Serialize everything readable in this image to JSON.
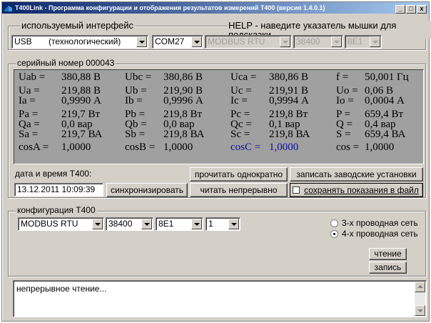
{
  "window": {
    "title": "T400Link - Программа конфигурации и отображения результатов измерений T400 (версия 1.4.0.1)",
    "controls": {
      "minimize": "_",
      "maximize": "□",
      "close": "x"
    }
  },
  "interface": {
    "label": "используемый интерфейс",
    "help": "HELP - наведите указатель мышки для подсказки",
    "type_value": "USB       (технологический)",
    "port_value": "COM27",
    "protocol_value": "MODBUS RTU",
    "baud_value": "38400",
    "format_value": "8E1"
  },
  "measurements": {
    "serial_label": "серийный номер 000043",
    "items": [
      {
        "label": "Uab =",
        "value": "380,88 В"
      },
      {
        "label": "Ubc =",
        "value": "380,86 В"
      },
      {
        "label": "Uca =",
        "value": "380,86 В"
      },
      {
        "label": "f =",
        "value": "50,001 Гц"
      },
      {
        "label": "Ua =",
        "value": "219,88 В"
      },
      {
        "label": "Ub =",
        "value": "219,90 В"
      },
      {
        "label": "Uc =",
        "value": "219,91 В"
      },
      {
        "label": "Uo =",
        "value": "0,06 В"
      },
      {
        "label": "Ia =",
        "value": "0,9990 А"
      },
      {
        "label": "Ib =",
        "value": "0,9996 А"
      },
      {
        "label": "Ic =",
        "value": "0,9994 А"
      },
      {
        "label": "Io =",
        "value": "0,0004 А"
      },
      {
        "label": "Pa =",
        "value": "219,7 Вт"
      },
      {
        "label": "Pb =",
        "value": "219,8 Вт"
      },
      {
        "label": "Pc =",
        "value": "219,8 Вт"
      },
      {
        "label": "P =",
        "value": "659,4 Вт"
      },
      {
        "label": "Qa =",
        "value": "0,0 вар"
      },
      {
        "label": "Qb =",
        "value": "0,0 вар"
      },
      {
        "label": "Qc =",
        "value": "0,1 вар"
      },
      {
        "label": "Q =",
        "value": "0,4 вар"
      },
      {
        "label": "Sa =",
        "value": "219,7 ВА"
      },
      {
        "label": "Sb =",
        "value": "219,8 ВА"
      },
      {
        "label": "Sc =",
        "value": "219,8 ВА"
      },
      {
        "label": "S =",
        "value": "659,4 ВА"
      },
      {
        "label": "cosA =",
        "value": "1,0000"
      },
      {
        "label": "cosB =",
        "value": "1,0000"
      },
      {
        "label": "cosC =",
        "value": "1,0000"
      },
      {
        "label": "cos =",
        "value": "1,0000"
      }
    ],
    "highlight_color": "#1010a0"
  },
  "datetime": {
    "label": "дата и время Т400:",
    "value": "13.12.2011 10:09:39",
    "sync_button": "синхронизировать",
    "read_once_button": "прочитать однократно",
    "read_continuous_button": "читать непрерывно",
    "write_factory_button": "записать заводские установки",
    "save_to_file_button": "сохранять показания в файл"
  },
  "config": {
    "label": "конфигурация Т400",
    "protocol_value": "MODBUS RTU",
    "baud_value": "38400",
    "format_value": "8E1",
    "address_value": "1",
    "radio_3wire": "3-х проводная сеть",
    "radio_4wire": "4-х проводная сеть",
    "selected_network": "4-wire",
    "read_button": "чтение",
    "write_button": "запись"
  },
  "log": {
    "text": "непрерывное чтение..."
  }
}
